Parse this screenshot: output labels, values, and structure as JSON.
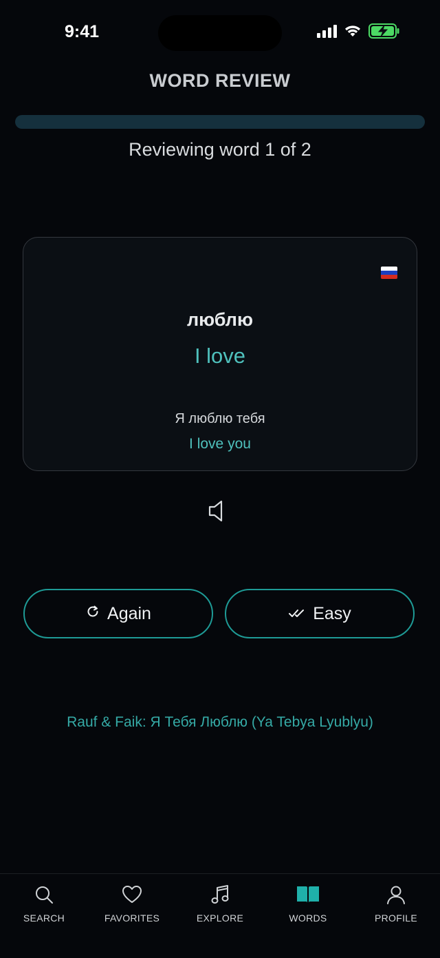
{
  "status": {
    "time": "9:41"
  },
  "header": {
    "title": "WORD REVIEW"
  },
  "progress": {
    "text": "Reviewing word 1 of 2",
    "fraction": 0
  },
  "card": {
    "flag": "russia-flag-icon",
    "word": "люблю",
    "translation": "I love",
    "example": "Я люблю тебя",
    "example_translation": "I love you"
  },
  "actions": {
    "again_label": "Again",
    "easy_label": "Easy"
  },
  "song": {
    "link": "Rauf & Faik: Я Тебя Люблю (Ya Tebya Lyublyu)"
  },
  "tabs": [
    {
      "label": "SEARCH",
      "icon": "search-icon"
    },
    {
      "label": "FAVORITES",
      "icon": "heart-icon"
    },
    {
      "label": "EXPLORE",
      "icon": "music-note-icon"
    },
    {
      "label": "WORDS",
      "icon": "book-icon",
      "active": true
    },
    {
      "label": "PROFILE",
      "icon": "user-icon"
    }
  ],
  "colors": {
    "accent": "#4fc1bd",
    "button_border": "#1e9b96",
    "active_tab": "#1fb0aa",
    "background": "#05070b"
  }
}
